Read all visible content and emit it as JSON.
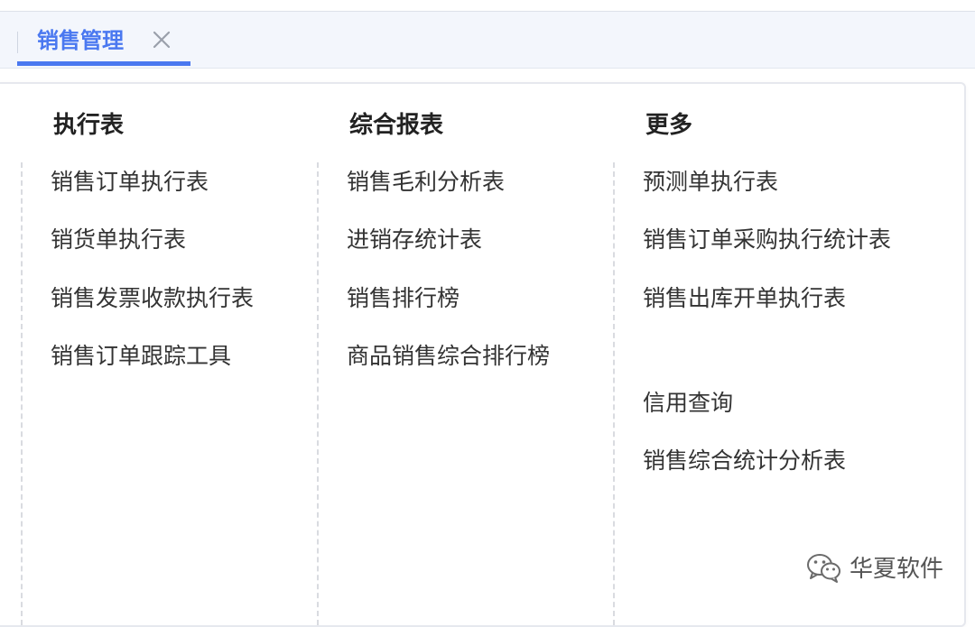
{
  "tabs": [
    {
      "label": "销售管理",
      "active": true,
      "closable": true,
      "close_icon": "close-icon"
    }
  ],
  "menu": {
    "columns": [
      {
        "heading": "执行表",
        "items": [
          "销售订单执行表",
          "销货单执行表",
          "销售发票收款执行表",
          "销售订单跟踪工具"
        ]
      },
      {
        "heading": "综合报表",
        "items": [
          "销售毛利分析表",
          "进销存统计表",
          "销售排行榜",
          "商品销售综合排行榜"
        ]
      },
      {
        "heading": "更多",
        "items": [
          "预测单执行表",
          "销售订单采购执行统计表",
          "销售出库开单执行表",
          "信用查询",
          "销售综合统计分析表"
        ]
      }
    ]
  },
  "watermark": {
    "icon": "wechat-icon",
    "text": "华夏软件"
  },
  "colors": {
    "accent": "#4a78f0",
    "heading_text": "#222222",
    "item_text": "#333333",
    "tabbar_bg": "#f3f6fc",
    "divider": "#d9dbe0"
  }
}
